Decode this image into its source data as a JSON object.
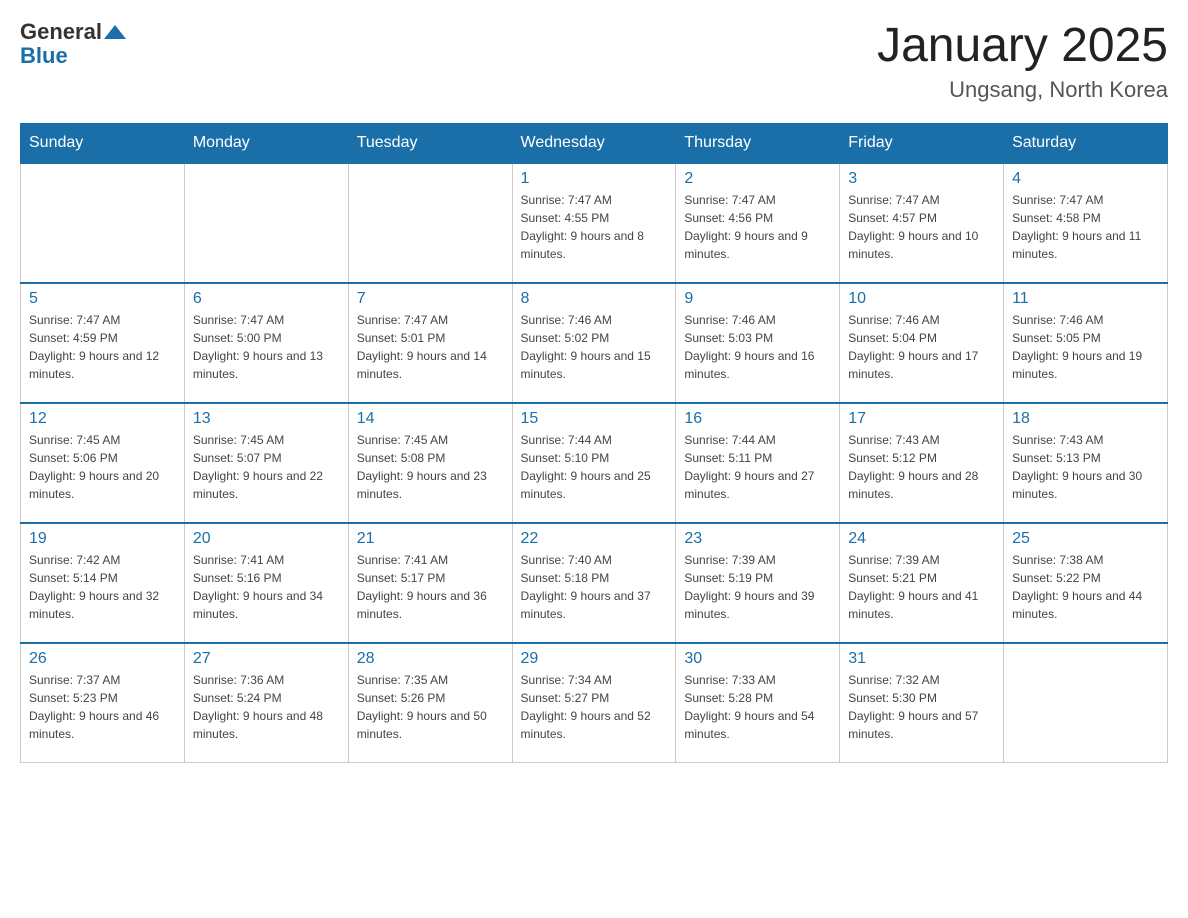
{
  "header": {
    "logo_general": "General",
    "logo_blue": "Blue",
    "month_title": "January 2025",
    "location": "Ungsang, North Korea"
  },
  "days_of_week": [
    "Sunday",
    "Monday",
    "Tuesday",
    "Wednesday",
    "Thursday",
    "Friday",
    "Saturday"
  ],
  "weeks": [
    [
      {
        "day": "",
        "info": ""
      },
      {
        "day": "",
        "info": ""
      },
      {
        "day": "",
        "info": ""
      },
      {
        "day": "1",
        "info": "Sunrise: 7:47 AM\nSunset: 4:55 PM\nDaylight: 9 hours and 8 minutes."
      },
      {
        "day": "2",
        "info": "Sunrise: 7:47 AM\nSunset: 4:56 PM\nDaylight: 9 hours and 9 minutes."
      },
      {
        "day": "3",
        "info": "Sunrise: 7:47 AM\nSunset: 4:57 PM\nDaylight: 9 hours and 10 minutes."
      },
      {
        "day": "4",
        "info": "Sunrise: 7:47 AM\nSunset: 4:58 PM\nDaylight: 9 hours and 11 minutes."
      }
    ],
    [
      {
        "day": "5",
        "info": "Sunrise: 7:47 AM\nSunset: 4:59 PM\nDaylight: 9 hours and 12 minutes."
      },
      {
        "day": "6",
        "info": "Sunrise: 7:47 AM\nSunset: 5:00 PM\nDaylight: 9 hours and 13 minutes."
      },
      {
        "day": "7",
        "info": "Sunrise: 7:47 AM\nSunset: 5:01 PM\nDaylight: 9 hours and 14 minutes."
      },
      {
        "day": "8",
        "info": "Sunrise: 7:46 AM\nSunset: 5:02 PM\nDaylight: 9 hours and 15 minutes."
      },
      {
        "day": "9",
        "info": "Sunrise: 7:46 AM\nSunset: 5:03 PM\nDaylight: 9 hours and 16 minutes."
      },
      {
        "day": "10",
        "info": "Sunrise: 7:46 AM\nSunset: 5:04 PM\nDaylight: 9 hours and 17 minutes."
      },
      {
        "day": "11",
        "info": "Sunrise: 7:46 AM\nSunset: 5:05 PM\nDaylight: 9 hours and 19 minutes."
      }
    ],
    [
      {
        "day": "12",
        "info": "Sunrise: 7:45 AM\nSunset: 5:06 PM\nDaylight: 9 hours and 20 minutes."
      },
      {
        "day": "13",
        "info": "Sunrise: 7:45 AM\nSunset: 5:07 PM\nDaylight: 9 hours and 22 minutes."
      },
      {
        "day": "14",
        "info": "Sunrise: 7:45 AM\nSunset: 5:08 PM\nDaylight: 9 hours and 23 minutes."
      },
      {
        "day": "15",
        "info": "Sunrise: 7:44 AM\nSunset: 5:10 PM\nDaylight: 9 hours and 25 minutes."
      },
      {
        "day": "16",
        "info": "Sunrise: 7:44 AM\nSunset: 5:11 PM\nDaylight: 9 hours and 27 minutes."
      },
      {
        "day": "17",
        "info": "Sunrise: 7:43 AM\nSunset: 5:12 PM\nDaylight: 9 hours and 28 minutes."
      },
      {
        "day": "18",
        "info": "Sunrise: 7:43 AM\nSunset: 5:13 PM\nDaylight: 9 hours and 30 minutes."
      }
    ],
    [
      {
        "day": "19",
        "info": "Sunrise: 7:42 AM\nSunset: 5:14 PM\nDaylight: 9 hours and 32 minutes."
      },
      {
        "day": "20",
        "info": "Sunrise: 7:41 AM\nSunset: 5:16 PM\nDaylight: 9 hours and 34 minutes."
      },
      {
        "day": "21",
        "info": "Sunrise: 7:41 AM\nSunset: 5:17 PM\nDaylight: 9 hours and 36 minutes."
      },
      {
        "day": "22",
        "info": "Sunrise: 7:40 AM\nSunset: 5:18 PM\nDaylight: 9 hours and 37 minutes."
      },
      {
        "day": "23",
        "info": "Sunrise: 7:39 AM\nSunset: 5:19 PM\nDaylight: 9 hours and 39 minutes."
      },
      {
        "day": "24",
        "info": "Sunrise: 7:39 AM\nSunset: 5:21 PM\nDaylight: 9 hours and 41 minutes."
      },
      {
        "day": "25",
        "info": "Sunrise: 7:38 AM\nSunset: 5:22 PM\nDaylight: 9 hours and 44 minutes."
      }
    ],
    [
      {
        "day": "26",
        "info": "Sunrise: 7:37 AM\nSunset: 5:23 PM\nDaylight: 9 hours and 46 minutes."
      },
      {
        "day": "27",
        "info": "Sunrise: 7:36 AM\nSunset: 5:24 PM\nDaylight: 9 hours and 48 minutes."
      },
      {
        "day": "28",
        "info": "Sunrise: 7:35 AM\nSunset: 5:26 PM\nDaylight: 9 hours and 50 minutes."
      },
      {
        "day": "29",
        "info": "Sunrise: 7:34 AM\nSunset: 5:27 PM\nDaylight: 9 hours and 52 minutes."
      },
      {
        "day": "30",
        "info": "Sunrise: 7:33 AM\nSunset: 5:28 PM\nDaylight: 9 hours and 54 minutes."
      },
      {
        "day": "31",
        "info": "Sunrise: 7:32 AM\nSunset: 5:30 PM\nDaylight: 9 hours and 57 minutes."
      },
      {
        "day": "",
        "info": ""
      }
    ]
  ]
}
